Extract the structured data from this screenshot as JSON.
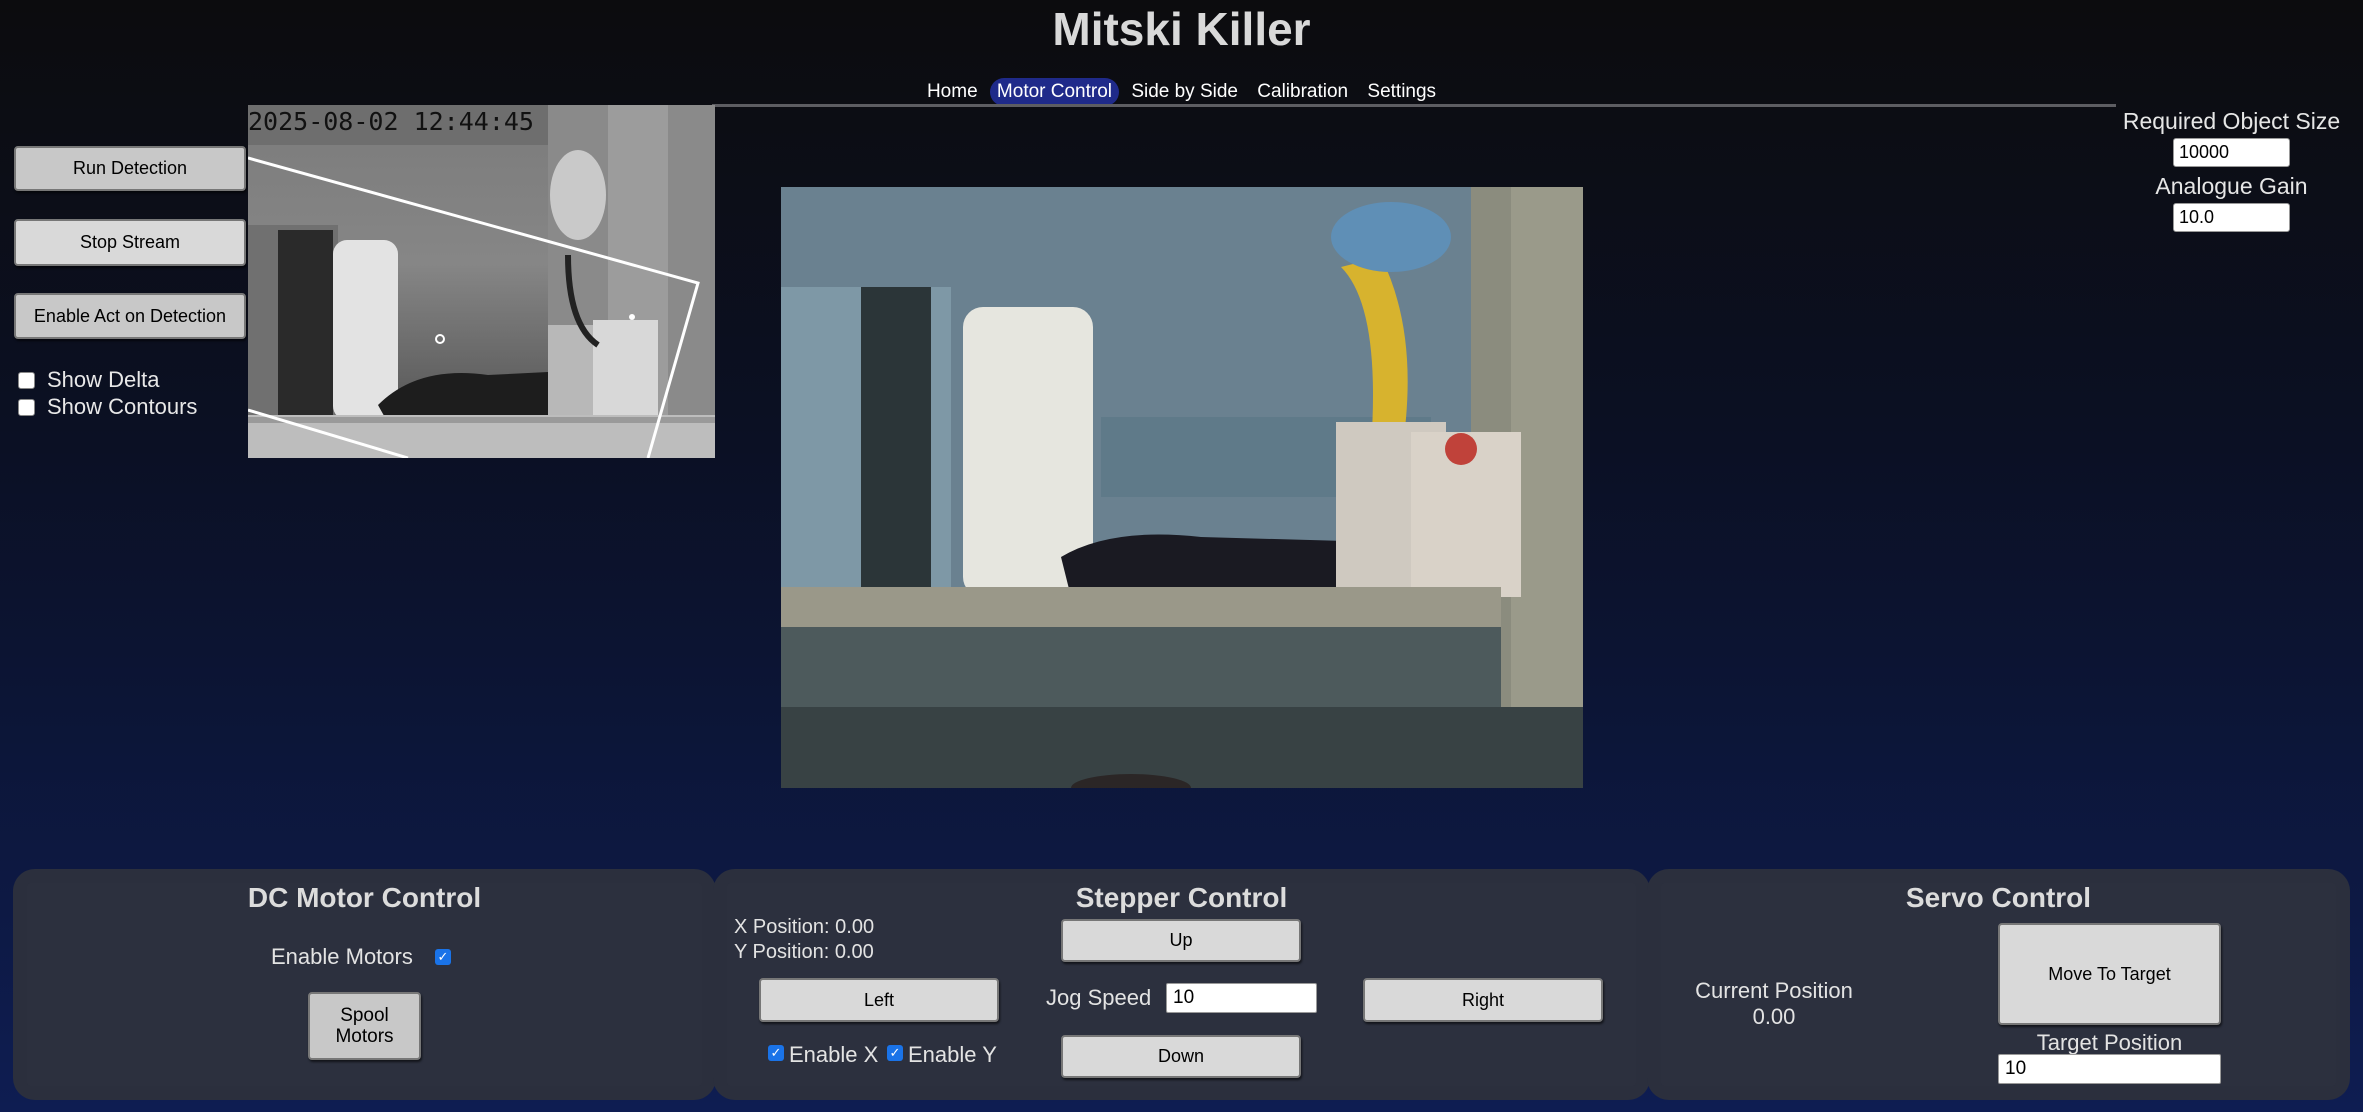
{
  "app": {
    "title": "Mitski Killer"
  },
  "nav": {
    "items": [
      {
        "label": "Home",
        "active": false
      },
      {
        "label": "Motor Control",
        "active": true
      },
      {
        "label": "Side by Side",
        "active": false
      },
      {
        "label": "Calibration",
        "active": false
      },
      {
        "label": "Settings",
        "active": false
      }
    ]
  },
  "controls": {
    "run_detection": "Run Detection",
    "stop_stream": "Stop Stream",
    "enable_act": "Enable Act on Detection",
    "show_delta": "Show Delta",
    "show_contours": "Show Contours",
    "show_delta_checked": false,
    "show_contours_checked": false
  },
  "camera": {
    "timestamp": "2025-08-02 12:44:45"
  },
  "settings": {
    "required_object_size_label": "Required Object Size",
    "required_object_size_value": "10000",
    "analogue_gain_label": "Analogue Gain",
    "analogue_gain_value": "10.0"
  },
  "dc_motor": {
    "title": "DC Motor Control",
    "enable_label": "Enable Motors",
    "enable_checked": true,
    "spool_line1": "Spool",
    "spool_line2": "Motors"
  },
  "stepper": {
    "title": "Stepper Control",
    "x_label": "X Position:",
    "x_value": "0.00",
    "y_label": "Y Position:",
    "y_value": "0.00",
    "up": "Up",
    "down": "Down",
    "left": "Left",
    "right": "Right",
    "jog_label": "Jog Speed",
    "jog_value": "10",
    "enable_x": "Enable X",
    "enable_y": "Enable Y",
    "enable_x_checked": true,
    "enable_y_checked": true
  },
  "servo": {
    "title": "Servo Control",
    "current_label": "Current Position",
    "current_value": "0.00",
    "move_button": "Move To Target",
    "target_label": "Target Position",
    "target_value": "10"
  },
  "colors": {
    "nav_active": "#1f2a8a",
    "panel_bg": "#2b2f3d",
    "checkbox_accent": "#1a73e8"
  }
}
